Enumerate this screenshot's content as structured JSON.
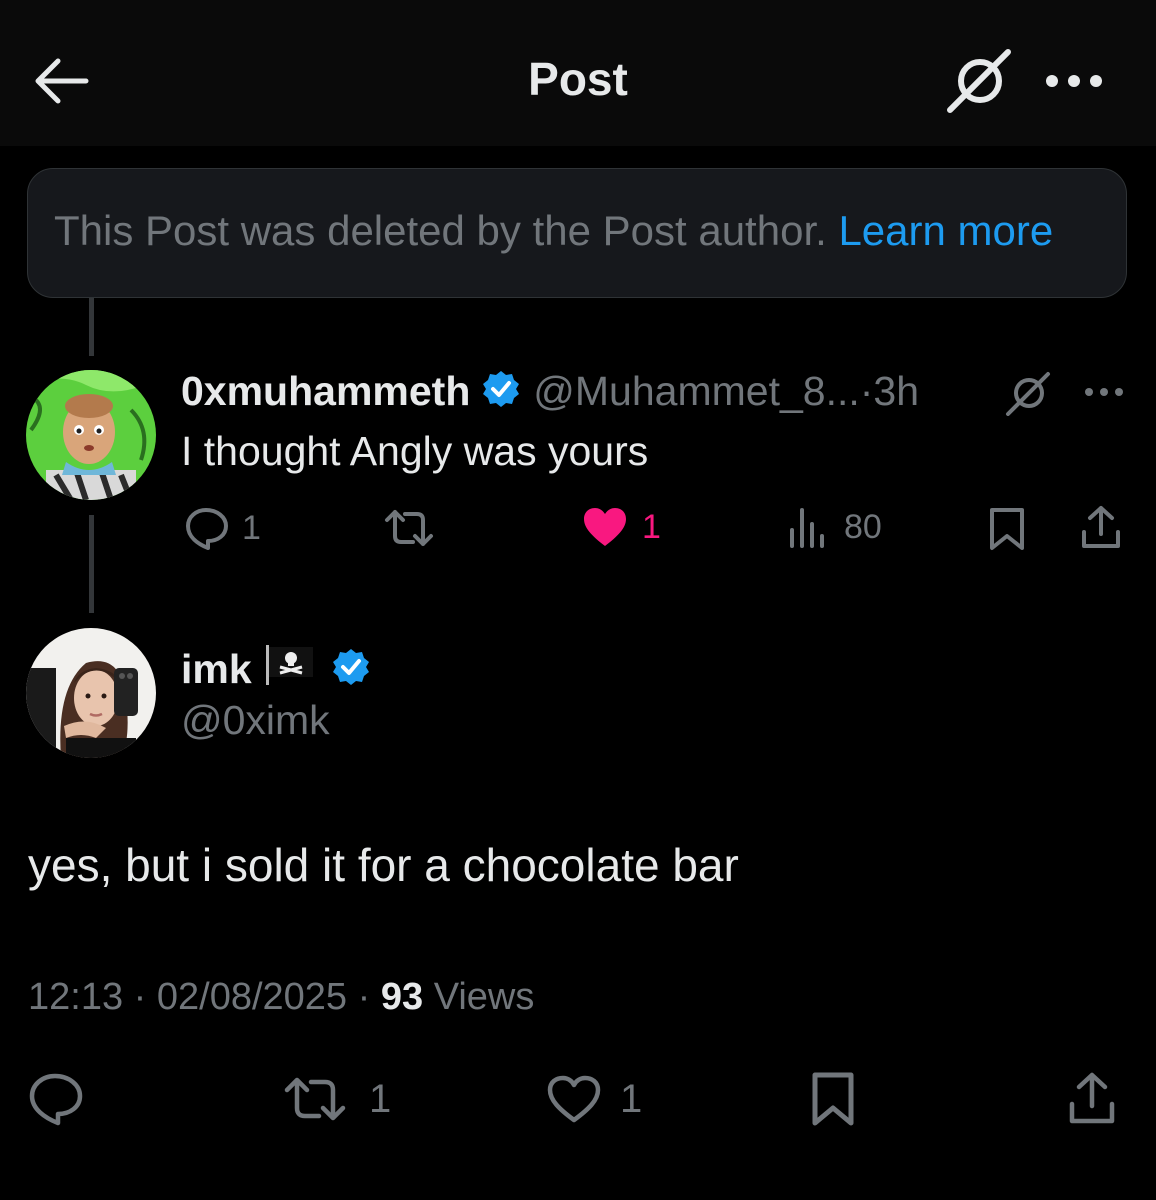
{
  "header": {
    "title": "Post",
    "back_icon": "arrow-left-icon",
    "grok_icon": "grok-icon",
    "more_icon": "more-horizontal-icon"
  },
  "notice": {
    "text": "This Post was deleted by the Post author.",
    "link": "Learn more"
  },
  "reply": {
    "name": "0xmuhammeth",
    "handle": "@Muhammet_8...",
    "dot": "·",
    "time": "3h",
    "text": "I thought Angly was yours",
    "replies": "1",
    "likes": "1",
    "views": "80"
  },
  "post": {
    "name": "imk",
    "flag": "🏴‍☠️",
    "handle": "@0ximk",
    "text": "yes, but i sold it for a chocolate bar",
    "time": "12:13",
    "sep1": "·",
    "date": "02/08/2025",
    "sep2": "·",
    "views_count": "93",
    "views_label": "Views",
    "reposts": "1",
    "likes": "1"
  },
  "colors": {
    "background": "#000000",
    "accent": "#1d9bf0",
    "like_pink": "#f91880",
    "muted": "#71767b",
    "text": "#e7e9ea"
  }
}
